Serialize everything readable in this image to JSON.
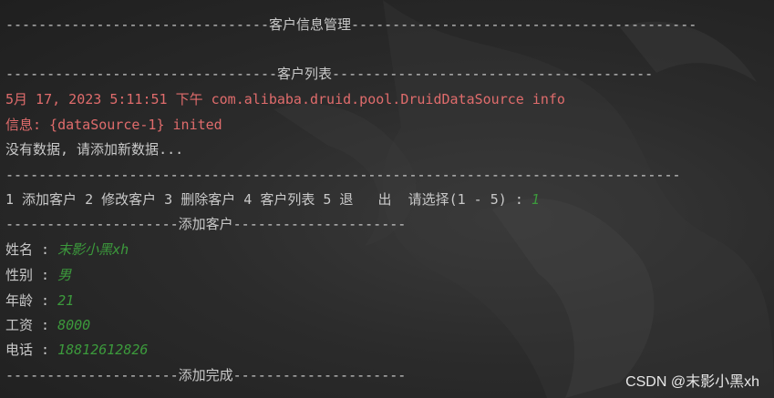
{
  "colors": {
    "background": "#2b2b2b",
    "text": "#c9c9c9",
    "error": "#e06c6c",
    "user_input": "#3c9a3c"
  },
  "console": {
    "header_line": "--------------------------------客户信息管理------------------------------------------",
    "blank": "",
    "list_header": "---------------------------------客户列表---------------------------------------",
    "log_line1": "5月 17, 2023 5:11:51 下午 com.alibaba.druid.pool.DruidDataSource info",
    "log_line2": "信息: {dataSource-1} inited",
    "no_data": "没有数据, 请添加新数据...",
    "separator": "----------------------------------------------------------------------------------",
    "menu_prompt": "1 添加客户 2 修改客户 3 删除客户 4 客户列表 5 退   出  请选择(1 - 5) : ",
    "menu_input": "1",
    "add_header": "---------------------添加客户---------------------",
    "fields": [
      {
        "label": "姓名 : ",
        "value": "末影小黑xh"
      },
      {
        "label": "性别 : ",
        "value": "男"
      },
      {
        "label": "年龄 : ",
        "value": "21"
      },
      {
        "label": "工资 : ",
        "value": "8000"
      },
      {
        "label": "电话 : ",
        "value": "18812612826"
      }
    ],
    "done_line": "---------------------添加完成---------------------"
  },
  "watermark": "CSDN @末影小黑xh"
}
